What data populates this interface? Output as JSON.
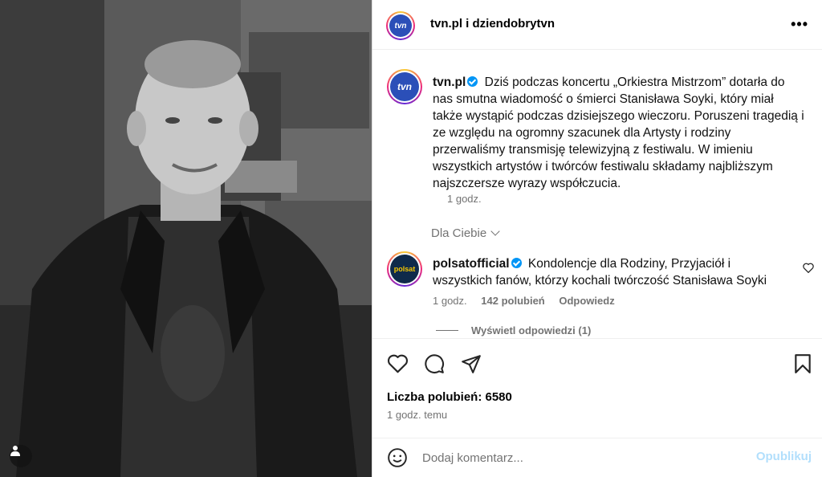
{
  "photo": {
    "alt_user_tag_icon": "user-icon"
  },
  "header": {
    "authors": "tvn.pl i dziendobrytvn",
    "more_icon": "•••"
  },
  "avatars": {
    "tvn_logo": "tvn",
    "polsat_logo": "polsat"
  },
  "caption": {
    "username": "tvn.pl",
    "text": "Dziś podczas koncertu „Orkiestra Mistrzom” dotarła do nas smutna wiadomość o śmierci Stanisława Soyki, który miał także wystąpić podczas dzisiejszego wieczoru. Poruszeni tragedią i ze względu na ogromny szacunek dla Artysty i rodziny przerwaliśmy transmisję telewizyjną z festiwalu. W imieniu wszystkich artystów i twórców festiwalu składamy najbliższym najszczersze wyrazy współczucia.",
    "time": "1 godz."
  },
  "for_you": "Dla Ciebie",
  "comment": {
    "username": "polsatofficial",
    "text": "Kondolencje dla Rodziny, Przyjaciół i wszystkich fanów, którzy kochali twórczość Stanisława Soyki",
    "time": "1 godz.",
    "likes": "142 polubień",
    "reply": "Odpowiedz",
    "view_replies": "Wyświetl odpowiedzi (1)"
  },
  "likes_count": "Liczba polubień: 6580",
  "posted": "1 godz. temu",
  "add_comment": {
    "placeholder": "Dodaj komentarz...",
    "post_label": "Opublikuj"
  },
  "colors": {
    "verified": "#0095f6",
    "muted": "#737373",
    "post_disabled": "#b2dffc"
  }
}
